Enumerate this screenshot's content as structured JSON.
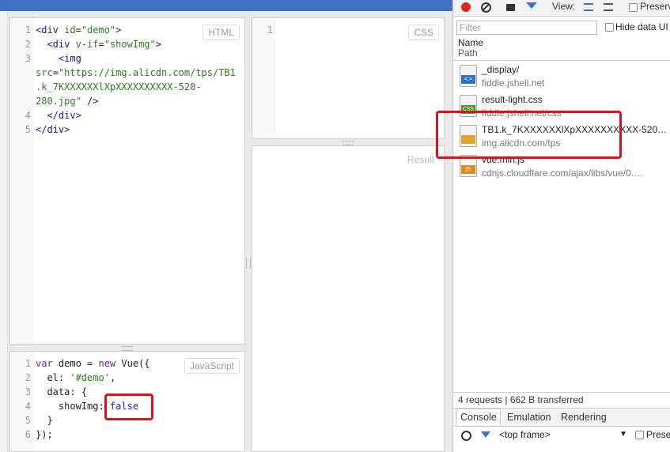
{
  "html_panel": {
    "label": "HTML",
    "lines": [
      {
        "num": "1",
        "parts": [
          {
            "t": "<div ",
            "c": "tag"
          },
          {
            "t": "id",
            "c": "attr"
          },
          {
            "t": "=",
            "c": "plain"
          },
          {
            "t": "\"demo\"",
            "c": "str"
          },
          {
            "t": ">",
            "c": "tag"
          }
        ]
      },
      {
        "num": "2",
        "parts": [
          {
            "t": "  <div ",
            "c": "tag"
          },
          {
            "t": "v-if",
            "c": "attr"
          },
          {
            "t": "=",
            "c": "plain"
          },
          {
            "t": "\"showImg\"",
            "c": "str"
          },
          {
            "t": ">",
            "c": "tag"
          }
        ]
      },
      {
        "num": "3",
        "parts": [
          {
            "t": "    <img",
            "c": "tag"
          }
        ]
      },
      {
        "num": "",
        "parts": [
          {
            "t": "src",
            "c": "attr"
          },
          {
            "t": "=",
            "c": "plain"
          },
          {
            "t": "\"https://img.alicdn.com/tps/TB1",
            "c": "str"
          }
        ]
      },
      {
        "num": "",
        "parts": [
          {
            "t": ".k_7KXXXXXXlXpXXXXXXXXXX-520-",
            "c": "str"
          }
        ]
      },
      {
        "num": "",
        "parts": [
          {
            "t": "280.jpg\"",
            "c": "str"
          },
          {
            "t": " />",
            "c": "tag"
          }
        ]
      },
      {
        "num": "4",
        "parts": [
          {
            "t": "  </div>",
            "c": "tag"
          }
        ]
      },
      {
        "num": "5",
        "parts": [
          {
            "t": "</div>",
            "c": "tag"
          }
        ]
      }
    ]
  },
  "css_panel": {
    "label": "CSS",
    "line_num": "1"
  },
  "js_panel": {
    "label": "JavaScript",
    "lines": [
      {
        "num": "1",
        "parts": [
          {
            "t": "var",
            "c": "kw"
          },
          {
            "t": " demo = ",
            "c": "plain"
          },
          {
            "t": "new",
            "c": "kw"
          },
          {
            "t": " Vue({",
            "c": "plain"
          }
        ]
      },
      {
        "num": "2",
        "parts": [
          {
            "t": "  el: ",
            "c": "plain"
          },
          {
            "t": "'#demo'",
            "c": "str"
          },
          {
            "t": ",",
            "c": "plain"
          }
        ]
      },
      {
        "num": "3",
        "parts": [
          {
            "t": "  data: {",
            "c": "plain"
          }
        ]
      },
      {
        "num": "4",
        "parts": [
          {
            "t": "    showImg: ",
            "c": "plain"
          },
          {
            "t": "false",
            "c": "lit"
          }
        ]
      },
      {
        "num": "5",
        "parts": [
          {
            "t": "  }",
            "c": "plain"
          }
        ]
      },
      {
        "num": "6",
        "parts": [
          {
            "t": "});",
            "c": "plain"
          }
        ]
      }
    ]
  },
  "result_panel": {
    "label": "Result"
  },
  "devtools": {
    "view_label": "View:",
    "preserve_label": "Preserv",
    "filter_placeholder": "Filter",
    "hide_data_label": "Hide data UI",
    "col_name": "Name",
    "col_path": "Path",
    "requests": [
      {
        "name": "_display/",
        "path": "fiddle.jshell.net",
        "icon": "html-doc-icon",
        "icon_text": "<>",
        "icon_color": "#2e6fcf"
      },
      {
        "name": "result-light.css",
        "path": "fiddle.jshell.net/css",
        "icon": "css-file-icon",
        "icon_text": "CSS",
        "icon_color": "#4c9a2a"
      },
      {
        "name": "TB1.k_7KXXXXXXlXpXXXXXXXXXX-520…",
        "path": "img.alicdn.com/tps",
        "icon": "image-file-icon",
        "icon_text": "",
        "icon_color": "#e2a52b"
      },
      {
        "name": "vue.min.js",
        "path": "cdnjs.cloudflare.com/ajax/libs/vue/0.…",
        "icon": "js-file-icon",
        "icon_text": "JS",
        "icon_color": "#e08a1e"
      }
    ],
    "summary": "4 requests  |  662 B transferred",
    "drawer_tabs": [
      "Console",
      "Emulation",
      "Rendering"
    ],
    "frame_select": "<top frame>",
    "preserve_log": "Prese"
  },
  "colors": {
    "highlight": "#e0101a",
    "record": "#e0261b",
    "accent_blue": "#3e73c3"
  }
}
